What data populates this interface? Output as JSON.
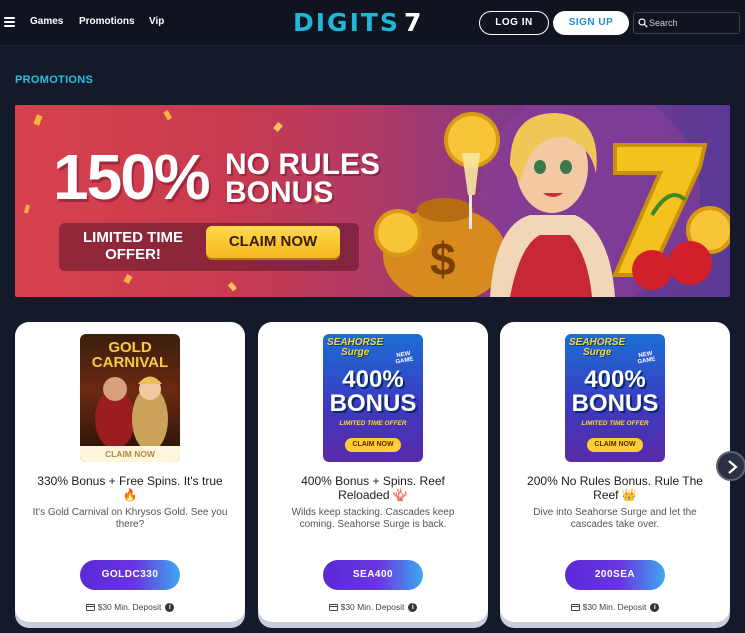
{
  "header": {
    "nav": [
      "Games",
      "Promotions",
      "Vip"
    ],
    "logo_word": "DIGITS",
    "logo_number": "7",
    "login_label": "LOG IN",
    "signup_label": "SIGN UP",
    "search_placeholder": "Search"
  },
  "section_title": "PROMOTIONS",
  "hero": {
    "headline": "150%",
    "subhead_line1": "NO RULES",
    "subhead_line2": "BONUS",
    "offer_line1": "LIMITED TIME",
    "offer_line2": "OFFER!",
    "claim_label": "CLAIM NOW"
  },
  "cards": [
    {
      "thumb_title_line1": "GOLD",
      "thumb_title_line2": "CARNIVAL",
      "thumb_claim": "CLAIM NOW",
      "title": "330% Bonus + Free Spins. It's true",
      "title_emoji": "🔥",
      "description": "It's Gold Carnival on Khrysos Gold. See you there?",
      "code": "GOLDC330",
      "deposit": "$30 Min. Deposit"
    },
    {
      "thumb_title_line1": "SEAHORSE",
      "thumb_title_line2": "Surge",
      "thumb_badge": "NEW GAME",
      "thumb_bonus_line1": "400%",
      "thumb_bonus_line2": "BONUS",
      "thumb_offer": "LIMITED TIME OFFER",
      "thumb_claim": "CLAIM NOW",
      "title": "400% Bonus + Spins. Reef Reloaded",
      "title_emoji": "🪸",
      "description": "Wilds keep stacking. Cascades keep coming. Seahorse Surge is back.",
      "code": "SEA400",
      "deposit": "$30 Min. Deposit"
    },
    {
      "thumb_title_line1": "SEAHORSE",
      "thumb_title_line2": "Surge",
      "thumb_badge": "NEW GAME",
      "thumb_bonus_line1": "400%",
      "thumb_bonus_line2": "BONUS",
      "thumb_offer": "LIMITED TIME OFFER",
      "thumb_claim": "CLAIM NOW",
      "title": "200% No Rules Bonus. Rule The Reef",
      "title_emoji": "👑",
      "description": "Dive into Seahorse Surge and let the cascades take over.",
      "code": "200SEA",
      "deposit": "$30 Min. Deposit"
    }
  ],
  "icons": {
    "menu": "hamburger-icon",
    "search": "search-icon",
    "next": "chevron-right-icon",
    "deposit_card": "credit-card-icon",
    "info": "info-icon"
  },
  "colors": {
    "background": "#141a29",
    "accent": "#27c2e0",
    "cta_yellow": "#f6b91d",
    "code_purple": "#5a2ad6",
    "code_blue": "#3ea8ef"
  }
}
